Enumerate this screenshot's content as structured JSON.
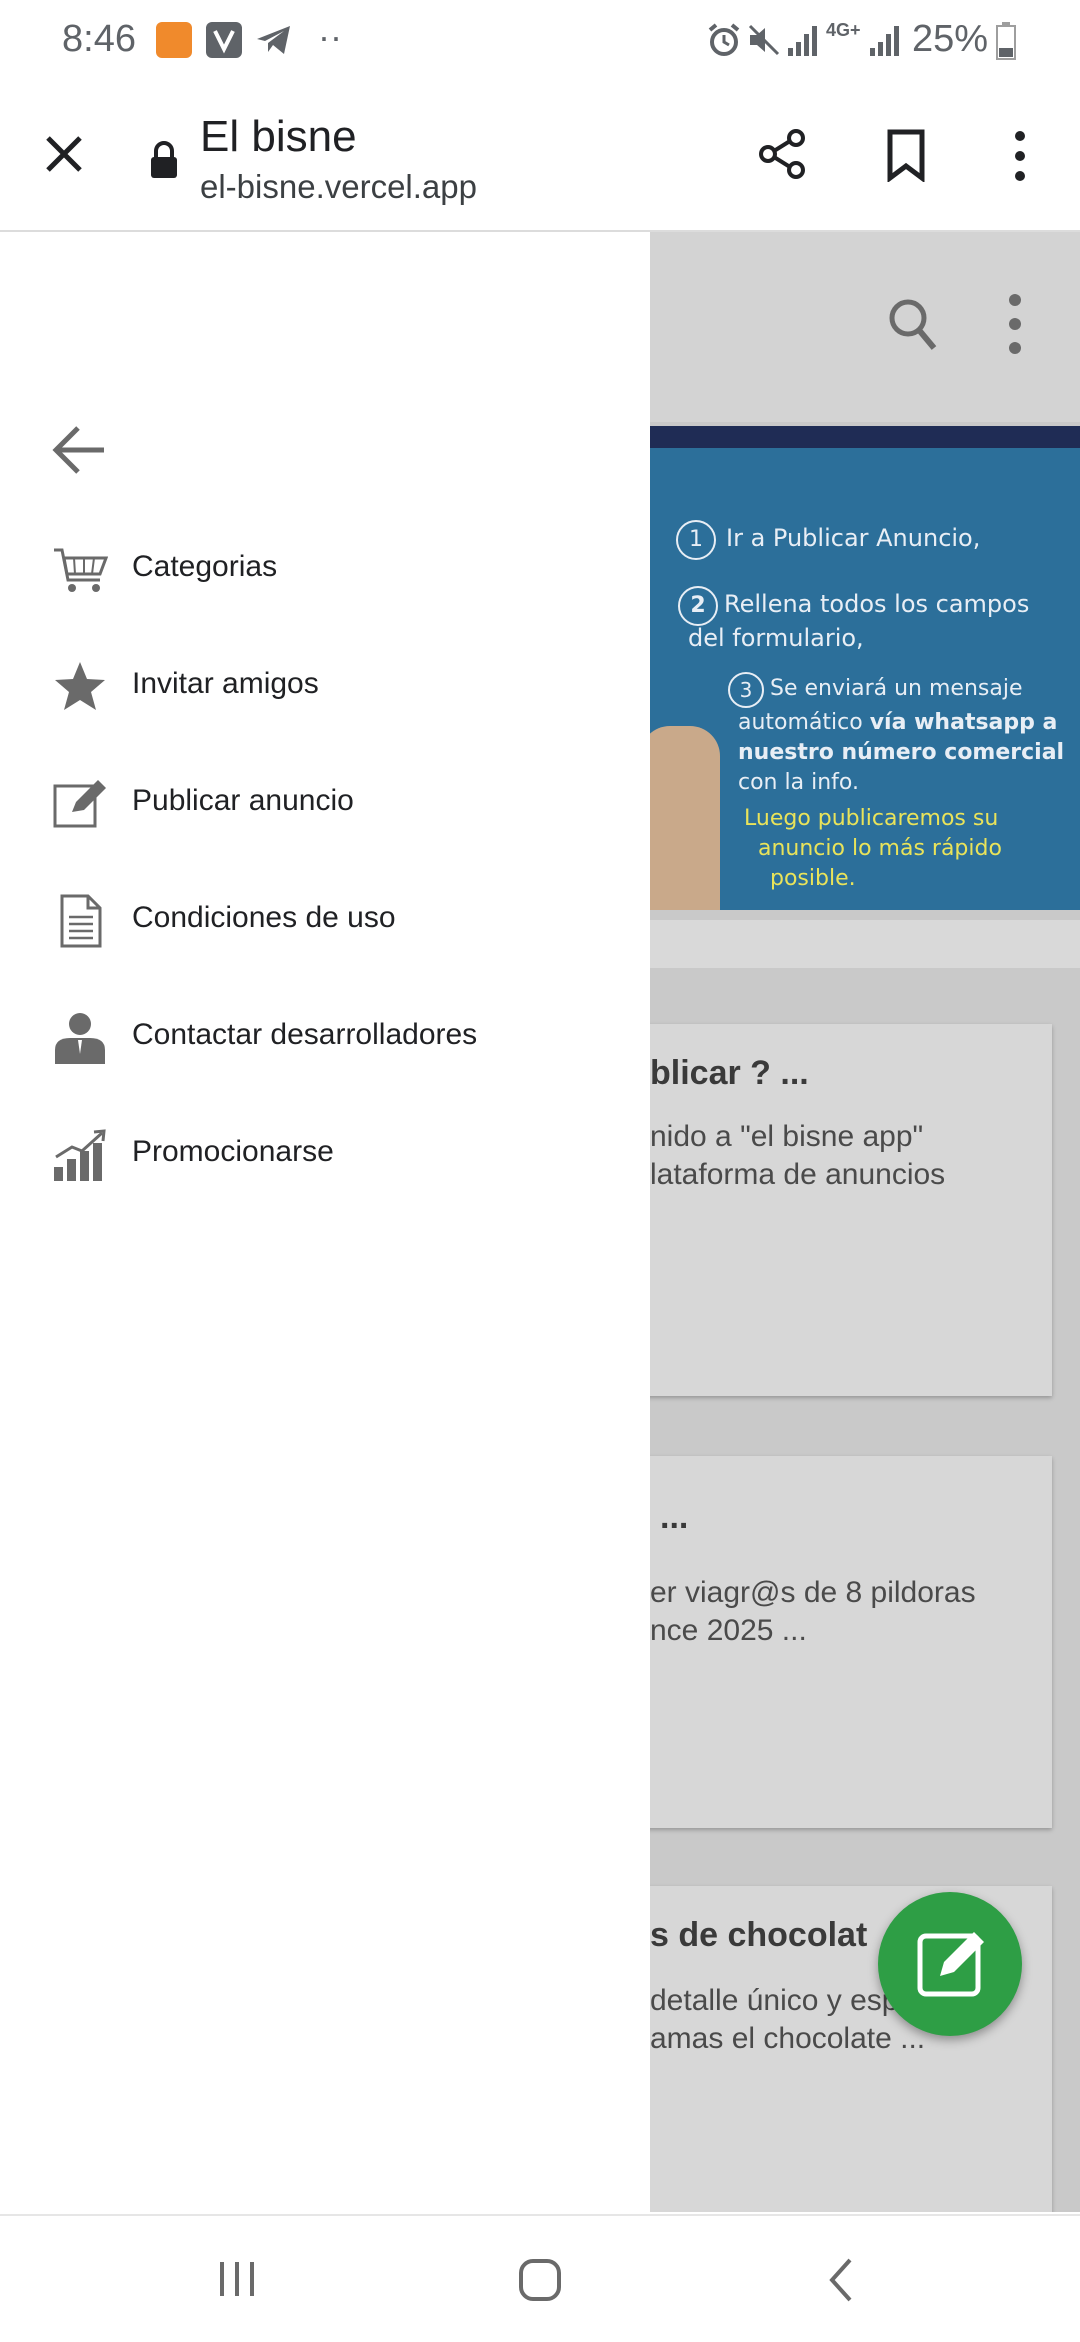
{
  "status_bar": {
    "time": "8:46",
    "battery": "25%",
    "network": "4G+",
    "more_indicator": "··"
  },
  "toolbar": {
    "title": "El bisne",
    "url": "el-bisne.vercel.app"
  },
  "drawer": {
    "items": [
      {
        "label": "Categorias",
        "icon": "cart-icon"
      },
      {
        "label": "Invitar amigos",
        "icon": "star-icon"
      },
      {
        "label": "Publicar anuncio",
        "icon": "edit-icon"
      },
      {
        "label": "Condiciones de uso",
        "icon": "document-icon"
      },
      {
        "label": "Contactar desarrolladores",
        "icon": "person-icon"
      },
      {
        "label": "Promocionarse",
        "icon": "bar-chart-icon"
      }
    ]
  },
  "banner": {
    "step1_num": "1",
    "step1": "Ir a Publicar Anuncio,",
    "step2_num": "2",
    "step2_a": "Rellena todos los campos",
    "step2_b": "del formulario,",
    "step3_num": "3",
    "step3_a": "Se enviará un mensaje",
    "step3_b1": "automático ",
    "step3_b2": "vía whatsapp a",
    "step3_c": "nuestro número comercial",
    "step3_d": "con la info.",
    "yellow_a": "Luego publicaremos su",
    "yellow_b": "anuncio lo más rápido",
    "yellow_c": "posible."
  },
  "cards": [
    {
      "title": "blicar ? ...",
      "line1": "nido a \"el bisne app\"",
      "line2": "lataforma de anuncios"
    },
    {
      "title": "...",
      "line1": "er viagr@s de 8 pildoras",
      "line2": "nce 2025 ..."
    },
    {
      "title": "s de chocolat",
      "line1": "detalle único y esp",
      "line2": "amas el chocolate ..."
    }
  ],
  "colors": {
    "fab": "#2e9e45",
    "banner": "#2c6f9a",
    "scrim": "#c9c9c9"
  }
}
